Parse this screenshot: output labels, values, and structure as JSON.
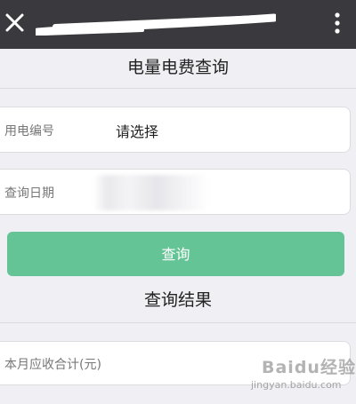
{
  "topbar": {
    "close_icon": "close-icon",
    "more_icon": "more-vertical-icon",
    "background": "#3a3a3e"
  },
  "page": {
    "title": "电量电费查询"
  },
  "form": {
    "account_label": "用电编号",
    "account_value": "请选择",
    "date_label": "查询日期",
    "query_button": "查询"
  },
  "result": {
    "title": "查询结果",
    "total_label": "本月应收合计(元)"
  },
  "watermark": {
    "brand": "Baidu经验",
    "site": "jingyan.baidu.com"
  },
  "colors": {
    "accent_green": "#64c495",
    "page_background": "#efeff4",
    "card_background": "#ffffff"
  }
}
